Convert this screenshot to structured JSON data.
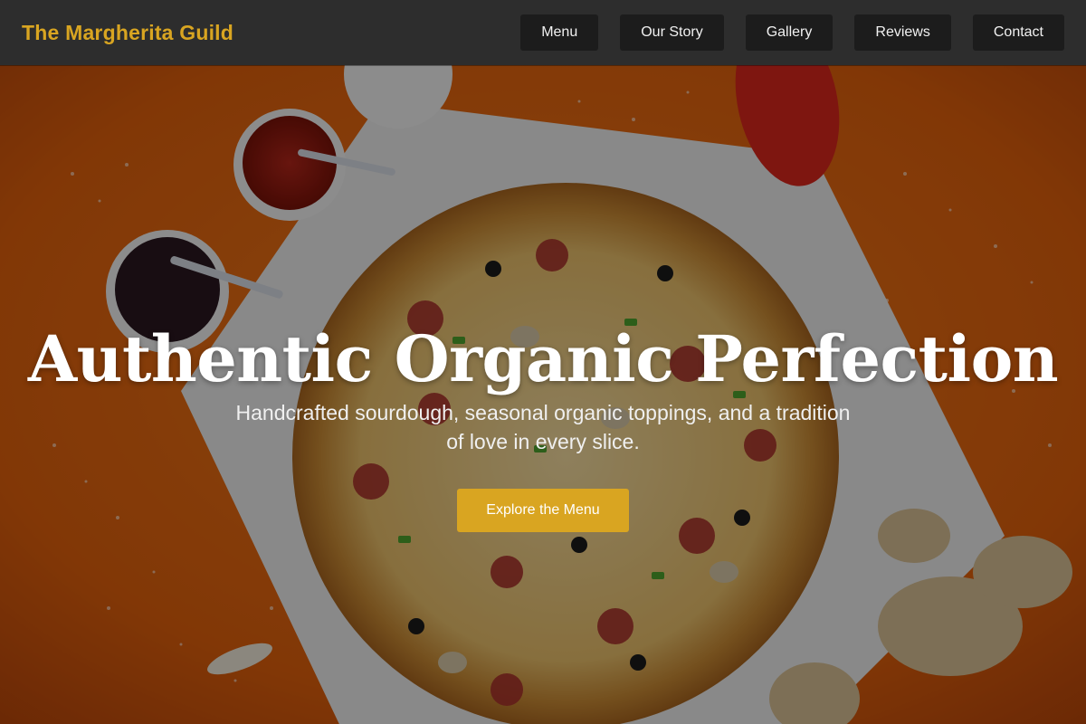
{
  "brand": {
    "name": "The Margherita Guild",
    "color": "#d9a521"
  },
  "nav": {
    "items": [
      {
        "label": "Menu"
      },
      {
        "label": "Our Story"
      },
      {
        "label": "Gallery"
      },
      {
        "label": "Reviews"
      },
      {
        "label": "Contact"
      }
    ]
  },
  "hero": {
    "title": "Authentic Organic Perfection",
    "subtitle": "Handcrafted sourdough, seasonal organic toppings, and a tradition of love in every slice.",
    "cta_label": "Explore the Menu",
    "background": "pizza-photo",
    "accent_color": "#d9a521"
  }
}
